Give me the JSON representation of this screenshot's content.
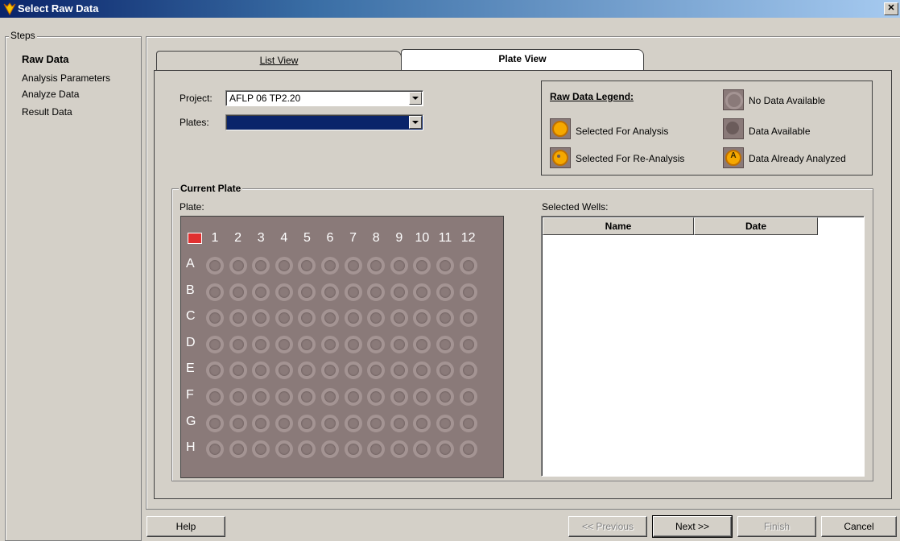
{
  "window": {
    "title": "Select Raw Data",
    "close_glyph": "✕"
  },
  "steps": {
    "legend": "Steps",
    "items": [
      {
        "label": "Raw Data",
        "active": true
      },
      {
        "label": "Analysis Parameters"
      },
      {
        "label": "Analyze Data"
      },
      {
        "label": "Result Data"
      }
    ]
  },
  "tabs": [
    {
      "label": "List View",
      "active": false
    },
    {
      "label": "Plate View",
      "active": true
    }
  ],
  "form": {
    "project_label": "Project:",
    "project_value": "AFLP 06 TP2.20",
    "plates_label": "Plates:",
    "plates_value": ""
  },
  "legend": {
    "title": "Raw Data Legend:",
    "items": [
      {
        "label": "No Data Available",
        "icon": "empty-well-icon"
      },
      {
        "label": "Selected For Analysis",
        "icon": "selected-well-icon",
        "color": "#f5a800"
      },
      {
        "label": "Data Available",
        "icon": "data-well-icon"
      },
      {
        "label": "Selected For Re-Analysis",
        "icon": "reanalysis-well-icon",
        "color": "#f5a800"
      },
      {
        "label": "Data Already Analyzed",
        "icon": "analyzed-well-icon",
        "color": "#f5a800",
        "letter": "A"
      }
    ]
  },
  "current_plate": {
    "title": "Current Plate",
    "plate_label": "Plate:",
    "columns": [
      "1",
      "2",
      "3",
      "4",
      "5",
      "6",
      "7",
      "8",
      "9",
      "10",
      "11",
      "12"
    ],
    "rows": [
      "A",
      "B",
      "C",
      "D",
      "E",
      "F",
      "G",
      "H"
    ]
  },
  "selected_wells": {
    "label": "Selected Wells:",
    "headers": [
      "Name",
      "Date"
    ],
    "rows": []
  },
  "buttons": {
    "help": "Help",
    "previous": "<< Previous",
    "next": "Next >>",
    "finish": "Finish",
    "cancel": "Cancel"
  },
  "colors": {
    "plate_bg": "#8a7a79",
    "accent": "#f5a800",
    "title_bar": "#0a246a",
    "corner_marker": "#e03030"
  }
}
